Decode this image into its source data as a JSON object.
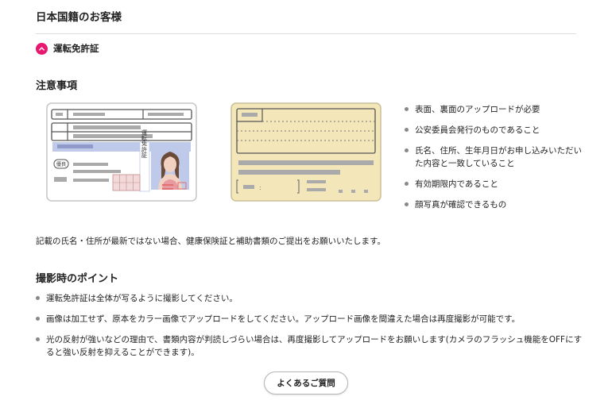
{
  "page_title": "日本国籍のお客様",
  "accordion": {
    "label": "運転免許証",
    "icon": "chevron-up-icon",
    "accent_color": "#e8176f"
  },
  "notes_section": {
    "heading": "注意事項",
    "license_front": {
      "vertical_label": "運転免許証",
      "badge": "優良"
    },
    "bullets": [
      "表面、裏面のアップロードが必要",
      "公安委員会発行のものであること",
      "氏名、住所、生年月日がお申し込みいただいた内容と一致していること",
      "有効期限内であること",
      "顔写真が確認できるもの"
    ],
    "note": "記載の氏名・住所が最新ではない場合、健康保険証と補助書類のご提出をお願いいたします。"
  },
  "tips_section": {
    "heading": "撮影時のポイント",
    "items": [
      "運転免許証は全体が写るように撮影してください。",
      "画像は加工せず、原本をカラー画像でアップロードをしてください。アップロード画像を間違えた場合は再度撮影が可能です。",
      "光の反射が強いなどの理由で、書類内容が判読しづらい場合は、再度撮影してアップロードをお願いします(カメラのフラッシュ機能をOFFにすると強い反射を抑えることができます)。"
    ]
  },
  "faq_button": "よくあるご質問",
  "colors": {
    "license_blue": "#bfc9ea",
    "license_back": "#f3e6b8",
    "text": "#222222"
  }
}
